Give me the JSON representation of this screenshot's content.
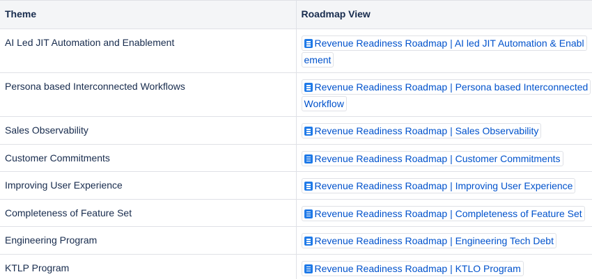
{
  "table": {
    "headers": [
      "Theme",
      "Roadmap View"
    ],
    "rows": [
      {
        "theme": "AI Led JIT Automation and Enablement",
        "link": "Revenue Readiness Roadmap | AI led JIT Automation & Enablement"
      },
      {
        "theme": "Persona based Interconnected Workflows",
        "link": "Revenue Readiness Roadmap | Persona based Interconnected Workflow"
      },
      {
        "theme": "Sales Observability",
        "link": "Revenue Readiness Roadmap | Sales Observability"
      },
      {
        "theme": "Customer Commitments",
        "link": "Revenue Readiness Roadmap | Customer Commitments"
      },
      {
        "theme": "Improving User Experience",
        "link": "Revenue Readiness Roadmap | Improving User Experience"
      },
      {
        "theme": "Completeness of Feature Set",
        "link": "Revenue Readiness Roadmap | Completeness of Feature Set"
      },
      {
        "theme": "Engineering Program",
        "link": "Revenue Readiness Roadmap | Engineering Tech Debt"
      },
      {
        "theme": "KTLP Program",
        "link": "Revenue Readiness Roadmap | KTLO Program"
      }
    ]
  },
  "icons": {
    "link_icon": "document-page-icon"
  },
  "colors": {
    "link": "#0052cc",
    "icon": "#1f7ae8",
    "header_bg": "#f4f5f7",
    "border": "#dfe1e6"
  }
}
